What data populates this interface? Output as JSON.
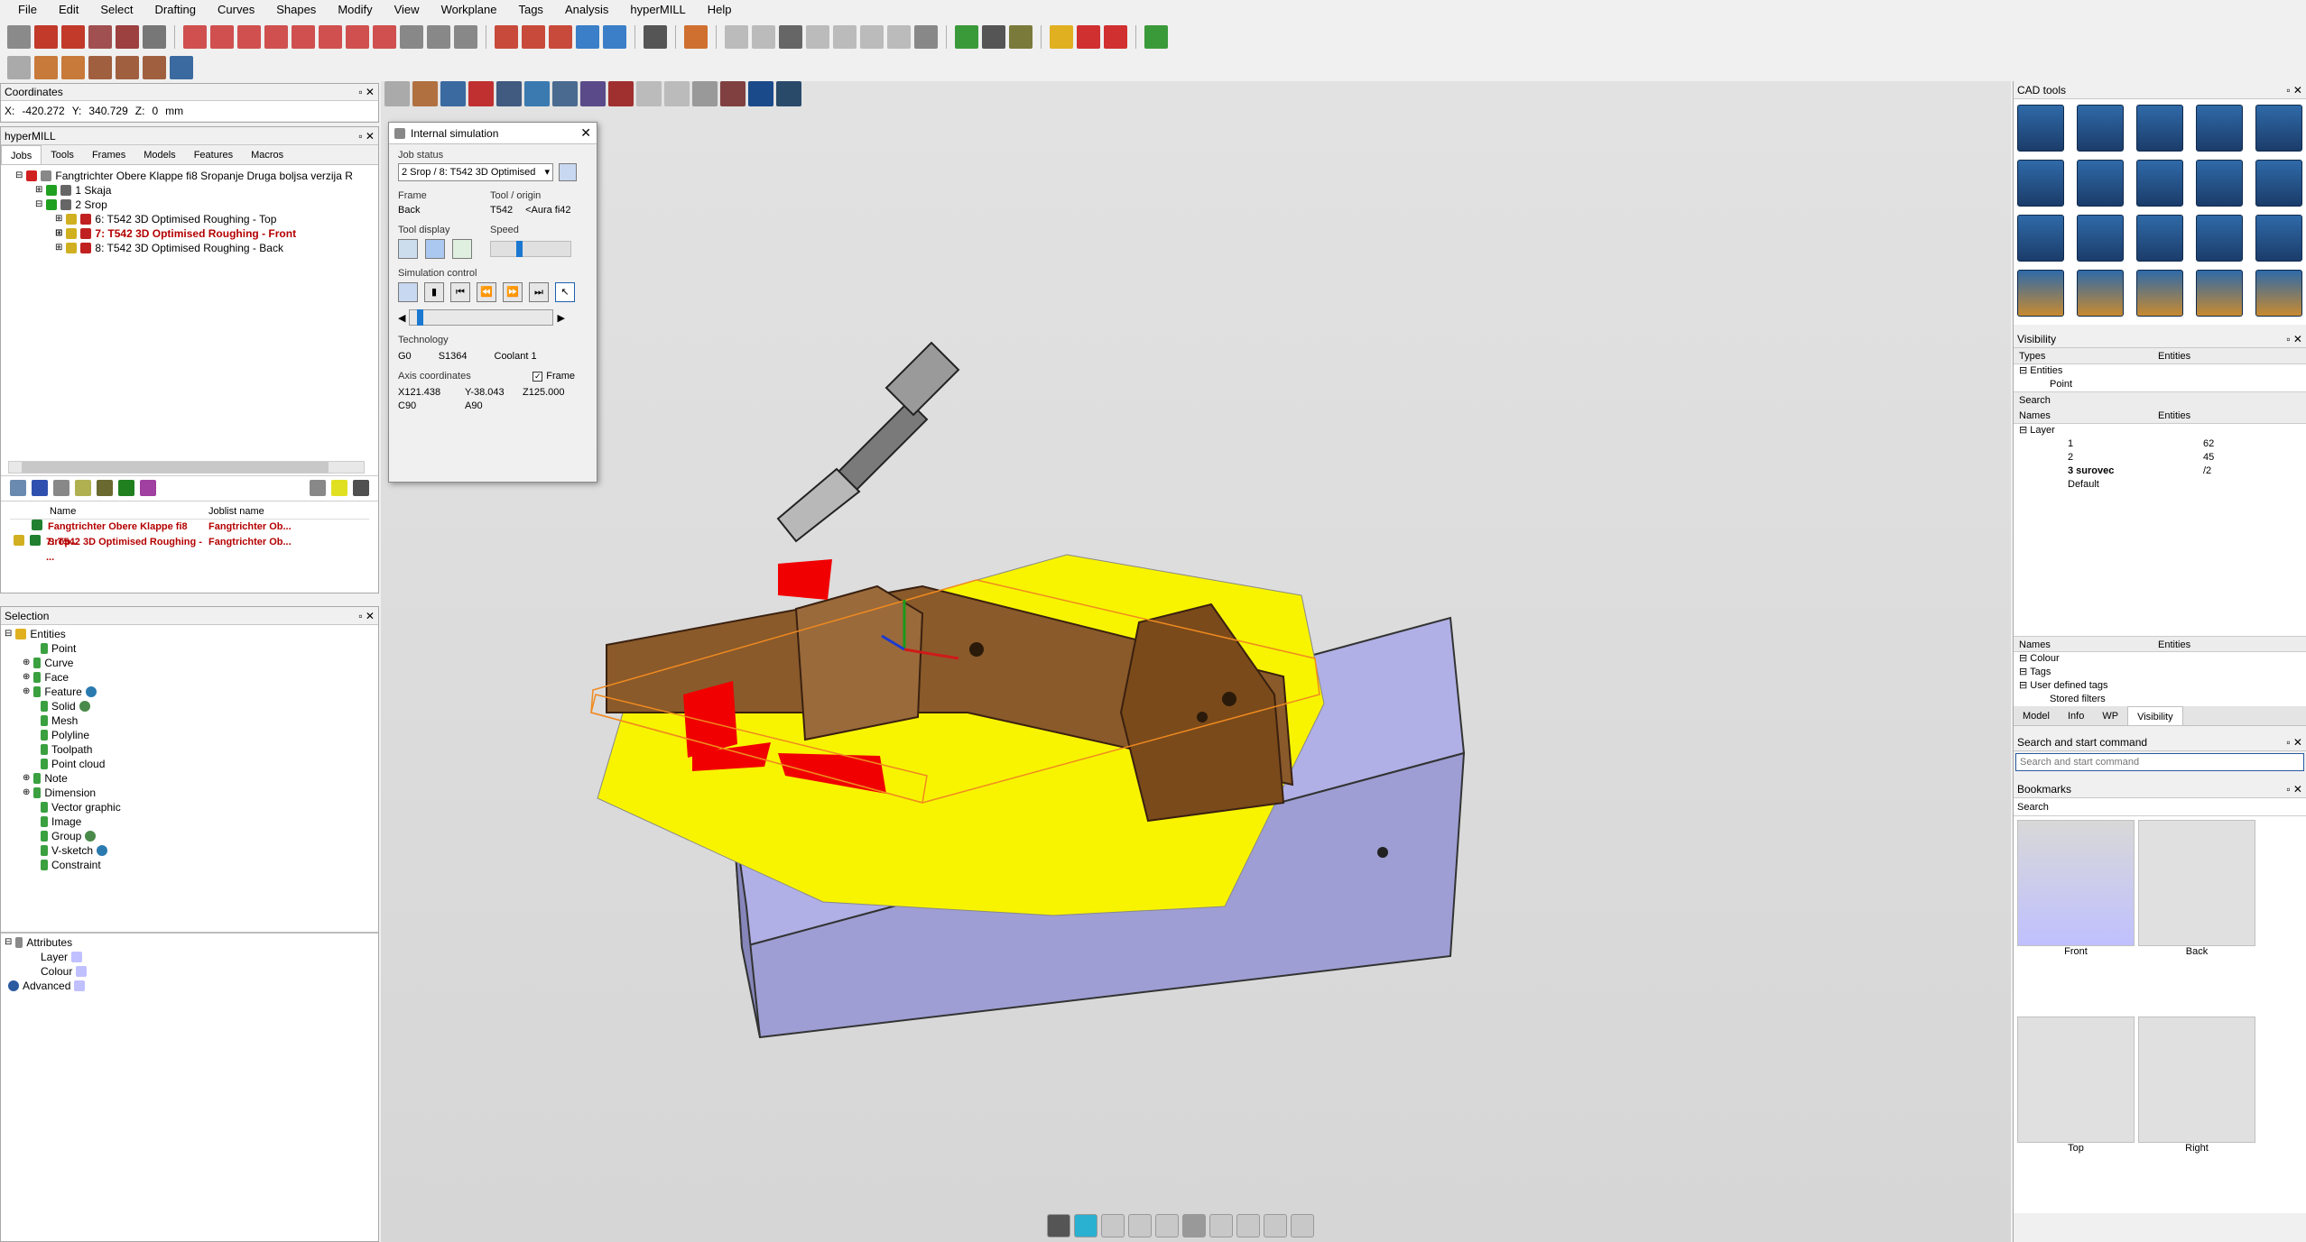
{
  "menu": [
    "File",
    "Edit",
    "Select",
    "Drafting",
    "Curves",
    "Shapes",
    "Modify",
    "View",
    "Workplane",
    "Tags",
    "Analysis",
    "hyperMILL",
    "Help"
  ],
  "coordinates": {
    "title": "Coordinates",
    "x_label": "X:",
    "x": "-420.272",
    "y_label": "Y:",
    "y": "340.729",
    "z_label": "Z:",
    "z": "0",
    "unit": "mm"
  },
  "hypermill": {
    "title": "hyperMILL",
    "tabs": [
      "Jobs",
      "Tools",
      "Frames",
      "Models",
      "Features",
      "Macros"
    ],
    "tree": [
      {
        "label": "Fangtrichter Obere Klappe fi8 Sropanje Druga boljsa verzija R",
        "level": 0
      },
      {
        "label": "1 Skaja",
        "level": 1
      },
      {
        "label": "2 Srop",
        "level": 1
      },
      {
        "label": "6: T542 3D Optimised Roughing - Top",
        "level": 2
      },
      {
        "label": "7: T542 3D Optimised Roughing - Front",
        "level": 2,
        "highlight": true
      },
      {
        "label": "8: T542 3D Optimised Roughing - Back",
        "level": 2
      }
    ],
    "joblist_headers": [
      "Name",
      "Joblist name"
    ],
    "joblist_rows": [
      {
        "name": "Fangtrichter Obere Klappe fi8 Srop...",
        "joblist": "Fangtrichter Ob..."
      },
      {
        "name": "7: T542 3D Optimised Roughing - ...",
        "joblist": "Fangtrichter Ob..."
      }
    ]
  },
  "selection": {
    "title": "Selection",
    "root": "Entities",
    "items": [
      "Point",
      "Curve",
      "Face",
      "Feature",
      "Solid",
      "Mesh",
      "Polyline",
      "Toolpath",
      "Point cloud",
      "Note",
      "Dimension",
      "Vector graphic",
      "Image",
      "Group",
      "V-sketch",
      "Constraint"
    ],
    "attributes": "Attributes",
    "attr_items": [
      "Layer",
      "Colour"
    ],
    "advanced": "Advanced"
  },
  "sim": {
    "title": "Internal simulation",
    "job_status_label": "Job status",
    "job_status": "2 Srop / 8: T542 3D Optimised",
    "frame_label": "Frame",
    "frame": "Back",
    "tool_label": "Tool / origin",
    "tool": "T542",
    "origin": "<Aura fi42",
    "tool_display_label": "Tool display",
    "speed_label": "Speed",
    "speed_level": 0.35,
    "sim_control_label": "Simulation control",
    "progress": 0.05,
    "technology_label": "Technology",
    "tech_g": "G0",
    "tech_s": "S1364",
    "tech_coolant": "Coolant 1",
    "axis_label": "Axis coordinates",
    "frame_check": "Frame",
    "ax_x": "X121.438",
    "ax_y": "Y-38.043",
    "ax_z": "Z125.000",
    "ax_c": "C90",
    "ax_a": "A90"
  },
  "cad_tools": {
    "title": "CAD tools"
  },
  "visibility": {
    "title": "Visibility",
    "types_header": "Types",
    "entities_header": "Entities",
    "types_root": "Entities",
    "types_child": "Point",
    "search": "Search",
    "names_header": "Names",
    "names_root": "Layer",
    "layers": [
      {
        "name": "1",
        "count": "62"
      },
      {
        "name": "2",
        "count": "45"
      },
      {
        "name": "3 surovec",
        "count": "/2"
      },
      {
        "name": "Default",
        "count": ""
      }
    ],
    "names2_header": "Names",
    "entities2_header": "Entities",
    "groups": [
      "Colour",
      "Tags",
      "User defined tags",
      "Stored filters"
    ],
    "tabs": [
      "Model",
      "Info",
      "WP",
      "Visibility"
    ]
  },
  "search_cmd": {
    "title": "Search and start command",
    "placeholder": "Search and start command"
  },
  "bookmarks": {
    "title": "Bookmarks",
    "search": "Search",
    "items": [
      "Front",
      "Back",
      "Top",
      "Right"
    ]
  }
}
